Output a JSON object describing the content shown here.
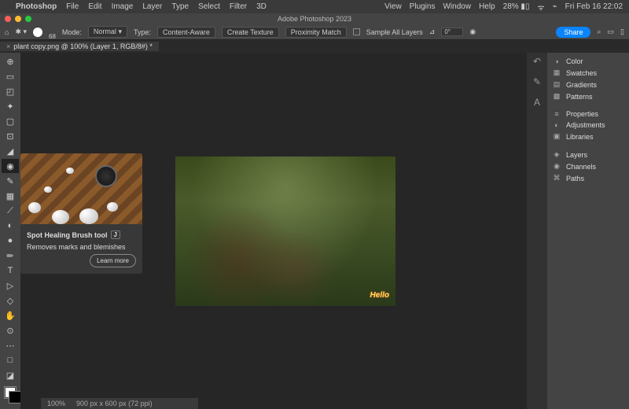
{
  "menubar": {
    "app": "Photoshop",
    "items": [
      "File",
      "Edit",
      "Image",
      "Layer",
      "Type",
      "Select",
      "Filter",
      "3D"
    ],
    "right": [
      "View",
      "Plugins",
      "Window",
      "Help"
    ],
    "battery": "28%",
    "datetime": "Fri Feb 16  22:02"
  },
  "window": {
    "title": "Adobe Photoshop 2023"
  },
  "options": {
    "brush_size": "68",
    "mode_label": "Mode:",
    "mode_value": "Normal",
    "type_label": "Type:",
    "btn1": "Content-Aware",
    "btn2": "Create Texture",
    "btn3": "Proximity Match",
    "sample": "Sample All Layers",
    "angle": "0°",
    "share": "Share"
  },
  "tab": {
    "name": "plant copy.png @ 100% (Layer 1, RGB/8#) *"
  },
  "tooltip": {
    "title": "Spot Healing Brush tool",
    "key": "J",
    "desc": "Removes marks and blemishes",
    "learn": "Learn more"
  },
  "panels": {
    "items": [
      {
        "icon": "◑",
        "label": "Color"
      },
      {
        "icon": "▦",
        "label": "Swatches"
      },
      {
        "icon": "▤",
        "label": "Gradients"
      },
      {
        "icon": "▩",
        "label": "Patterns"
      },
      {
        "sep": true
      },
      {
        "icon": "≡",
        "label": "Properties"
      },
      {
        "icon": "◐",
        "label": "Adjustments"
      },
      {
        "icon": "▣",
        "label": "Libraries"
      },
      {
        "sep": true
      },
      {
        "icon": "◈",
        "label": "Layers"
      },
      {
        "icon": "◉",
        "label": "Channels"
      },
      {
        "icon": "⌘",
        "label": "Paths"
      }
    ]
  },
  "status": {
    "zoom": "100%",
    "dims": "900 px x 600 px (72 ppi)"
  },
  "tools": [
    "⊕",
    "▭",
    "◰",
    "✦",
    "▢",
    "⊡",
    "◢",
    "◉",
    "✎",
    "▦",
    "⟋",
    "◐",
    "●",
    "✏",
    "T",
    "▷",
    "◇",
    "✋",
    "⊙",
    "⋯",
    "□",
    "◪"
  ]
}
